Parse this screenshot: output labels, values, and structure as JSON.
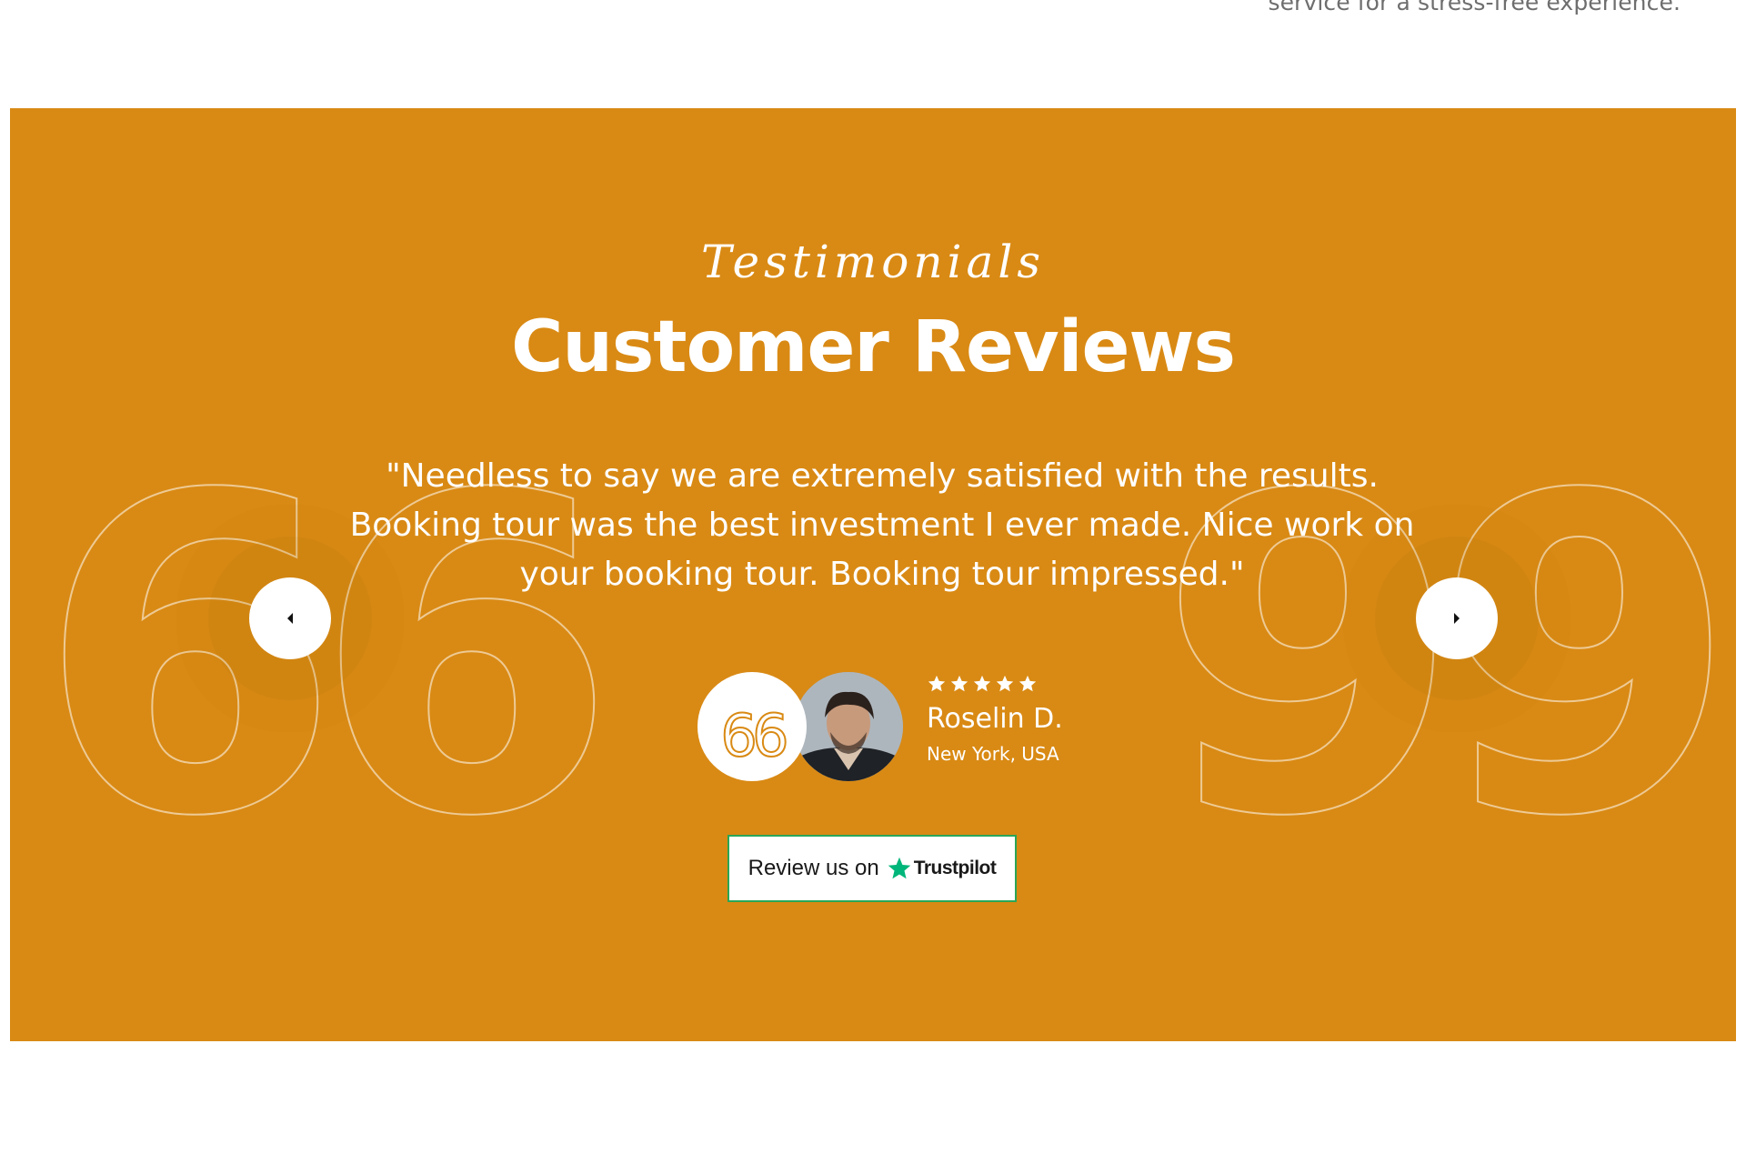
{
  "top_snippet": "service for a stress-free experience.",
  "testimonials": {
    "background_color": "#d98a14",
    "eyebrow": "Testimonials",
    "title": "Customer Reviews",
    "quote_open_mark": "66",
    "quote_close_mark": "99",
    "quote": "\"Needless to say we are extremely satisfied with the results. Booking tour was the best investment I ever made. Nice work on your booking tour. Booking tour impressed.\"",
    "prev_icon": "caret-left-icon",
    "next_icon": "caret-right-icon",
    "author": {
      "badge_mark": "66",
      "rating": 5,
      "name": "Roselin D.",
      "location": "New York, USA"
    },
    "review_button": {
      "label": "Review us on",
      "brand": "Trustpilot",
      "brand_color": "#00b67a",
      "border_color": "#2aa657"
    }
  }
}
